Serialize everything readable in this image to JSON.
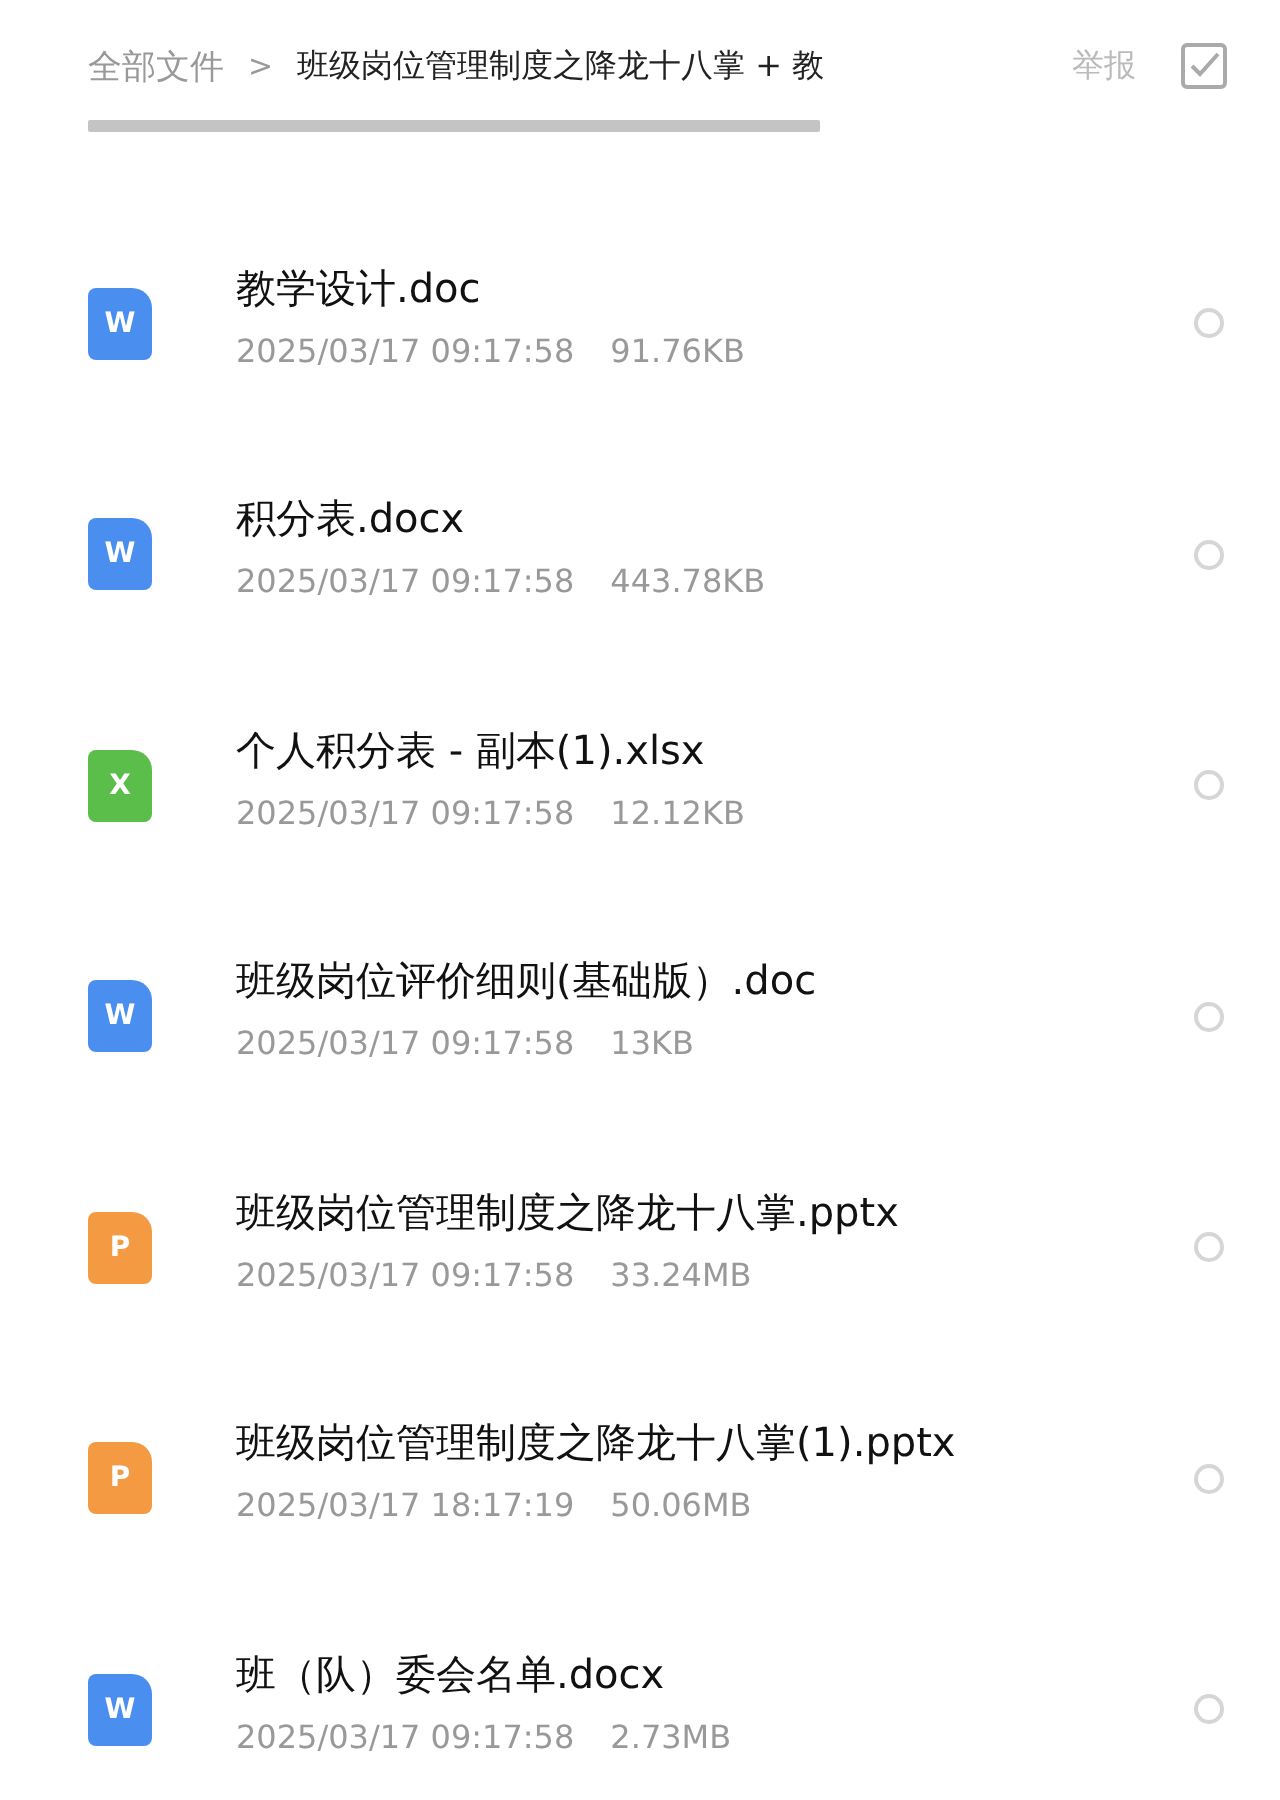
{
  "breadcrumb": {
    "root": "全部文件",
    "separator": ">",
    "current": "班级岗位管理制度之降龙十八掌 + 教"
  },
  "report": "举报",
  "files": [
    {
      "kind": "word",
      "badge": "W",
      "name": "教学设计.doc",
      "date": "2025/03/17 09:17:58",
      "size": "91.76KB",
      "selected": false
    },
    {
      "kind": "word",
      "badge": "W",
      "name": "积分表.docx",
      "date": "2025/03/17 09:17:58",
      "size": "443.78KB",
      "selected": false
    },
    {
      "kind": "excel",
      "badge": "X",
      "name": "个人积分表 - 副本(1).xlsx",
      "date": "2025/03/17 09:17:58",
      "size": "12.12KB",
      "selected": false
    },
    {
      "kind": "word",
      "badge": "W",
      "name": "班级岗位评价细则(基础版）.doc",
      "date": "2025/03/17 09:17:58",
      "size": "13KB",
      "selected": false
    },
    {
      "kind": "ppt",
      "badge": "P",
      "name": "班级岗位管理制度之降龙十八掌.pptx",
      "date": "2025/03/17 09:17:58",
      "size": "33.24MB",
      "selected": false
    },
    {
      "kind": "ppt",
      "badge": "P",
      "name": "班级岗位管理制度之降龙十八掌(1).pptx",
      "date": "2025/03/17 18:17:19",
      "size": "50.06MB",
      "selected": false
    },
    {
      "kind": "word",
      "badge": "W",
      "name": "班（队）委会名单.docx",
      "date": "2025/03/17 09:17:58",
      "size": "2.73MB",
      "selected": false
    }
  ]
}
